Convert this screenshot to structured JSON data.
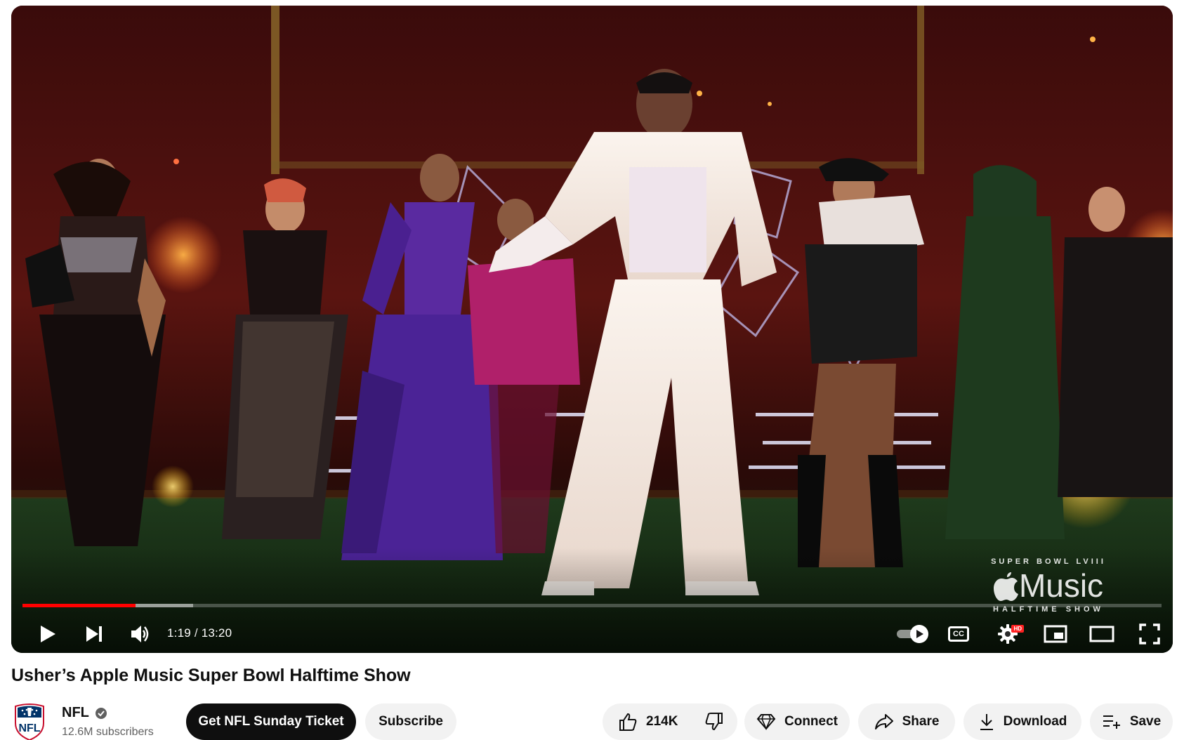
{
  "player": {
    "time_current": "1:19",
    "time_separator": "/",
    "time_total": "13:20",
    "progress_played_fraction": 0.099,
    "progress_buffered_fraction": 0.15,
    "accent_color": "#ff0000",
    "hd_badge": "HD",
    "cc_label": "CC",
    "watermark": {
      "top": "SUPER BOWL LVIII",
      "brand": "Music",
      "bottom": "HALFTIME SHOW"
    },
    "icons": {
      "play": "play-icon",
      "next": "next-icon",
      "volume": "volume-icon",
      "autoplay": "autoplay-toggle-icon",
      "captions": "captions-icon",
      "settings": "gear-icon",
      "miniplayer": "miniplayer-icon",
      "theater": "theater-mode-icon",
      "fullscreen": "fullscreen-icon"
    }
  },
  "video": {
    "title": "Usher’s Apple Music Super Bowl Halftime Show"
  },
  "channel": {
    "name": "NFL",
    "subscribers": "12.6M subscribers",
    "verified": true
  },
  "actions": {
    "ticket_label": "Get NFL Sunday Ticket",
    "subscribe_label": "Subscribe",
    "like_count": "214K",
    "connect_label": "Connect",
    "share_label": "Share",
    "download_label": "Download",
    "save_label": "Save"
  }
}
